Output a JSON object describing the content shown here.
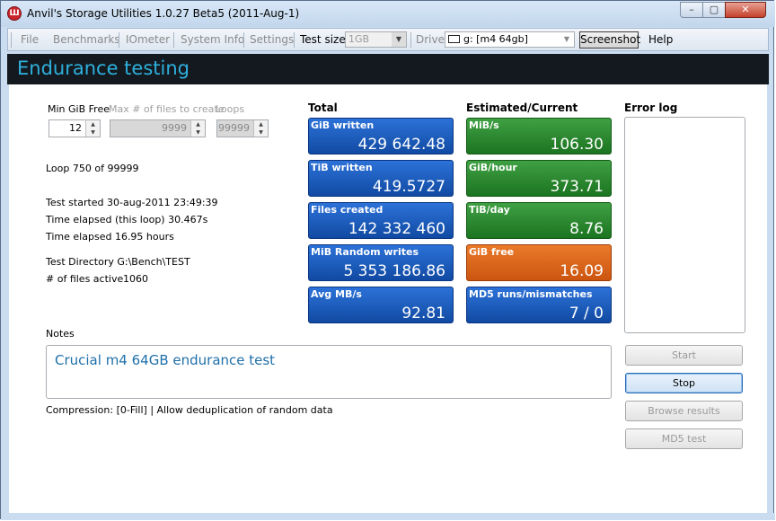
{
  "window": {
    "title": "Anvil's Storage Utilities 1.0.27 Beta5 (2011-Aug-1)",
    "app_icon_glyph": "Ш",
    "buttons": {
      "minimize": "–",
      "maximize": "▢",
      "close": "✕"
    }
  },
  "menu": {
    "items": [
      "File",
      "Benchmarks",
      "IOmeter",
      "System Info",
      "Settings"
    ],
    "test_size_label": "Test size",
    "test_size_value": "1GB",
    "drive_label": "Drive",
    "drive_value": "g: [m4 64gb]",
    "screenshot_label": "Screenshot",
    "help_label": "Help",
    "dropdown_arrow": "▼"
  },
  "header": {
    "title": "Endurance testing"
  },
  "params": {
    "min_gib_free_label": "Min GiB Free",
    "min_gib_free_value": "12",
    "max_files_label": "Max # of files to create",
    "max_files_value": "9999",
    "loops_label": "Loops",
    "loops_value": "99999",
    "spin_up": "▲",
    "spin_down": "▼"
  },
  "info": {
    "loop": "Loop 750 of 99999",
    "test_started": "Test started 30-aug-2011 23:49:39",
    "elapsed_loop": "Time elapsed (this loop) 30.467s",
    "elapsed_total": "Time elapsed 16.95 hours",
    "test_directory": "Test Directory G:\\Bench\\TEST",
    "files_active_label": "# of files active",
    "files_active_value": "1060"
  },
  "total": {
    "heading": "Total",
    "tiles": [
      {
        "label": "GiB written",
        "value": "429 642.48"
      },
      {
        "label": "TiB written",
        "value": "419.5727"
      },
      {
        "label": "Files created",
        "value": "142 332 460"
      },
      {
        "label": "MiB Random writes",
        "value": "5 353 186.86"
      },
      {
        "label": "Avg MB/s",
        "value": "92.81"
      }
    ]
  },
  "estimated": {
    "heading": "Estimated/Current",
    "tiles": [
      {
        "label": "MiB/s",
        "value": "106.30"
      },
      {
        "label": "GiB/hour",
        "value": "373.71"
      },
      {
        "label": "TiB/day",
        "value": "8.76"
      },
      {
        "label": "GiB free",
        "value": "16.09"
      },
      {
        "label": "MD5 runs/mismatches",
        "value": "7 / 0"
      }
    ]
  },
  "error_log": {
    "heading": "Error log"
  },
  "notes": {
    "label": "Notes",
    "text": "Crucial m4 64GB endurance test",
    "compression": "Compression: [0-Fill] | Allow deduplication of random data"
  },
  "actions": {
    "start": "Start",
    "stop": "Stop",
    "browse": "Browse results",
    "md5": "MD5 test"
  },
  "colors": {
    "tile_blue": "#1b5cc0",
    "tile_green": "#2a8a2f",
    "tile_orange": "#e06a1c",
    "header_bg": "#13191f",
    "header_text": "#2fb0dd",
    "notes_text": "#1f6fa8"
  }
}
